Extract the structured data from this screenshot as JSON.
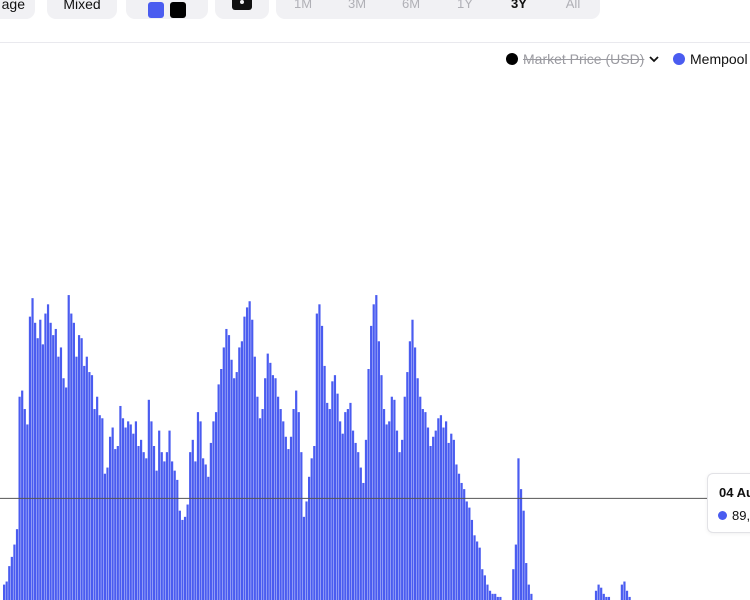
{
  "toolbar": {
    "view_left_label": "age",
    "view_mixed_label": "Mixed",
    "colors": {
      "series": "#4a5cf0",
      "price": "#000000"
    },
    "camera_icon": "camera-icon",
    "ranges": [
      {
        "label": "1M",
        "active": false
      },
      {
        "label": "3M",
        "active": false
      },
      {
        "label": "6M",
        "active": false
      },
      {
        "label": "1Y",
        "active": false
      },
      {
        "label": "3Y",
        "active": true
      },
      {
        "label": "All",
        "active": false
      }
    ]
  },
  "legend": {
    "price_label": "Market Price (USD)",
    "price_hidden": true,
    "mempool_label": "Mempool",
    "mempool_color": "#4a5cf0",
    "chevron_icon": "chevron-down-icon"
  },
  "tooltip": {
    "date": "04 Au",
    "value": "89,"
  },
  "chart_data": {
    "type": "bar",
    "title": "",
    "xlabel": "",
    "ylabel": "",
    "series": [
      {
        "name": "Mempool",
        "color": "#4a5cf0",
        "values": [
          0.05,
          0.06,
          0.11,
          0.14,
          0.18,
          0.23,
          0.66,
          0.68,
          0.62,
          0.57,
          0.92,
          0.98,
          0.9,
          0.85,
          0.91,
          0.83,
          0.93,
          0.96,
          0.9,
          0.86,
          0.88,
          0.79,
          0.82,
          0.72,
          0.69,
          0.99,
          0.93,
          0.9,
          0.79,
          0.86,
          0.85,
          0.76,
          0.79,
          0.74,
          0.73,
          0.62,
          0.66,
          0.6,
          0.59,
          0.41,
          0.43,
          0.53,
          0.56,
          0.49,
          0.5,
          0.63,
          0.59,
          0.56,
          0.58,
          0.57,
          0.54,
          0.58,
          0.5,
          0.52,
          0.48,
          0.46,
          0.65,
          0.58,
          0.5,
          0.42,
          0.55,
          0.48,
          0.45,
          0.48,
          0.55,
          0.45,
          0.42,
          0.39,
          0.29,
          0.26,
          0.27,
          0.31,
          0.48,
          0.52,
          0.45,
          0.61,
          0.58,
          0.46,
          0.44,
          0.4,
          0.51,
          0.58,
          0.61,
          0.7,
          0.75,
          0.82,
          0.88,
          0.86,
          0.78,
          0.72,
          0.74,
          0.82,
          0.84,
          0.92,
          0.95,
          0.97,
          0.91,
          0.79,
          0.66,
          0.59,
          0.62,
          0.72,
          0.8,
          0.77,
          0.73,
          0.72,
          0.66,
          0.62,
          0.58,
          0.53,
          0.49,
          0.53,
          0.62,
          0.68,
          0.61,
          0.48,
          0.27,
          0.32,
          0.4,
          0.46,
          0.5,
          0.93,
          0.96,
          0.89,
          0.76,
          0.64,
          0.62,
          0.71,
          0.73,
          0.67,
          0.58,
          0.54,
          0.61,
          0.62,
          0.64,
          0.55,
          0.51,
          0.48,
          0.43,
          0.38,
          0.52,
          0.75,
          0.89,
          0.96,
          0.99,
          0.84,
          0.73,
          0.62,
          0.57,
          0.58,
          0.66,
          0.65,
          0.55,
          0.48,
          0.52,
          0.66,
          0.74,
          0.84,
          0.91,
          0.82,
          0.72,
          0.66,
          0.62,
          0.61,
          0.56,
          0.5,
          0.53,
          0.55,
          0.59,
          0.6,
          0.56,
          0.58,
          0.51,
          0.54,
          0.52,
          0.44,
          0.41,
          0.38,
          0.36,
          0.32,
          0.3,
          0.26,
          0.21,
          0.19,
          0.17,
          0.1,
          0.08,
          0.05,
          0.03,
          0.02,
          0.02,
          0.01,
          0.01,
          0.0,
          0.0,
          0.0,
          0.0,
          0.1,
          0.18,
          0.46,
          0.36,
          0.29,
          0.12,
          0.05,
          0.02,
          0.0,
          0.0,
          0.0,
          0.0,
          0.0,
          0.0,
          0.0,
          0.0,
          0.0,
          0.0,
          0.0,
          0.0,
          0.0,
          0.0,
          0.0,
          0.0,
          0.0,
          0.0,
          0.0,
          0.0,
          0.0,
          0.0,
          0.0,
          0.0,
          0.03,
          0.05,
          0.04,
          0.02,
          0.01,
          0.01,
          0.0,
          0.0,
          0.0,
          0.0,
          0.05,
          0.06,
          0.03,
          0.01,
          0.0,
          0.0,
          0.0,
          0.0,
          0.0,
          0.0,
          0.0,
          0.0,
          0.0,
          0.0,
          0.0,
          0.0,
          0.0,
          0.0,
          0.0,
          0.0,
          0.0,
          0.0,
          0.0,
          0.0,
          0.0,
          0.0,
          0.0,
          0.0,
          0.0,
          0.0,
          0.0,
          0.0,
          0.0,
          0.0,
          0.0,
          0.0,
          0.0,
          0.0,
          0.0,
          0.0,
          0.0,
          0.0,
          0.0,
          0.0,
          0.0,
          0.0,
          0.0,
          0.0,
          0.0,
          0.0
        ]
      }
    ],
    "crosshair_level": 0.33,
    "grid": false,
    "legend_position": "top-right"
  }
}
